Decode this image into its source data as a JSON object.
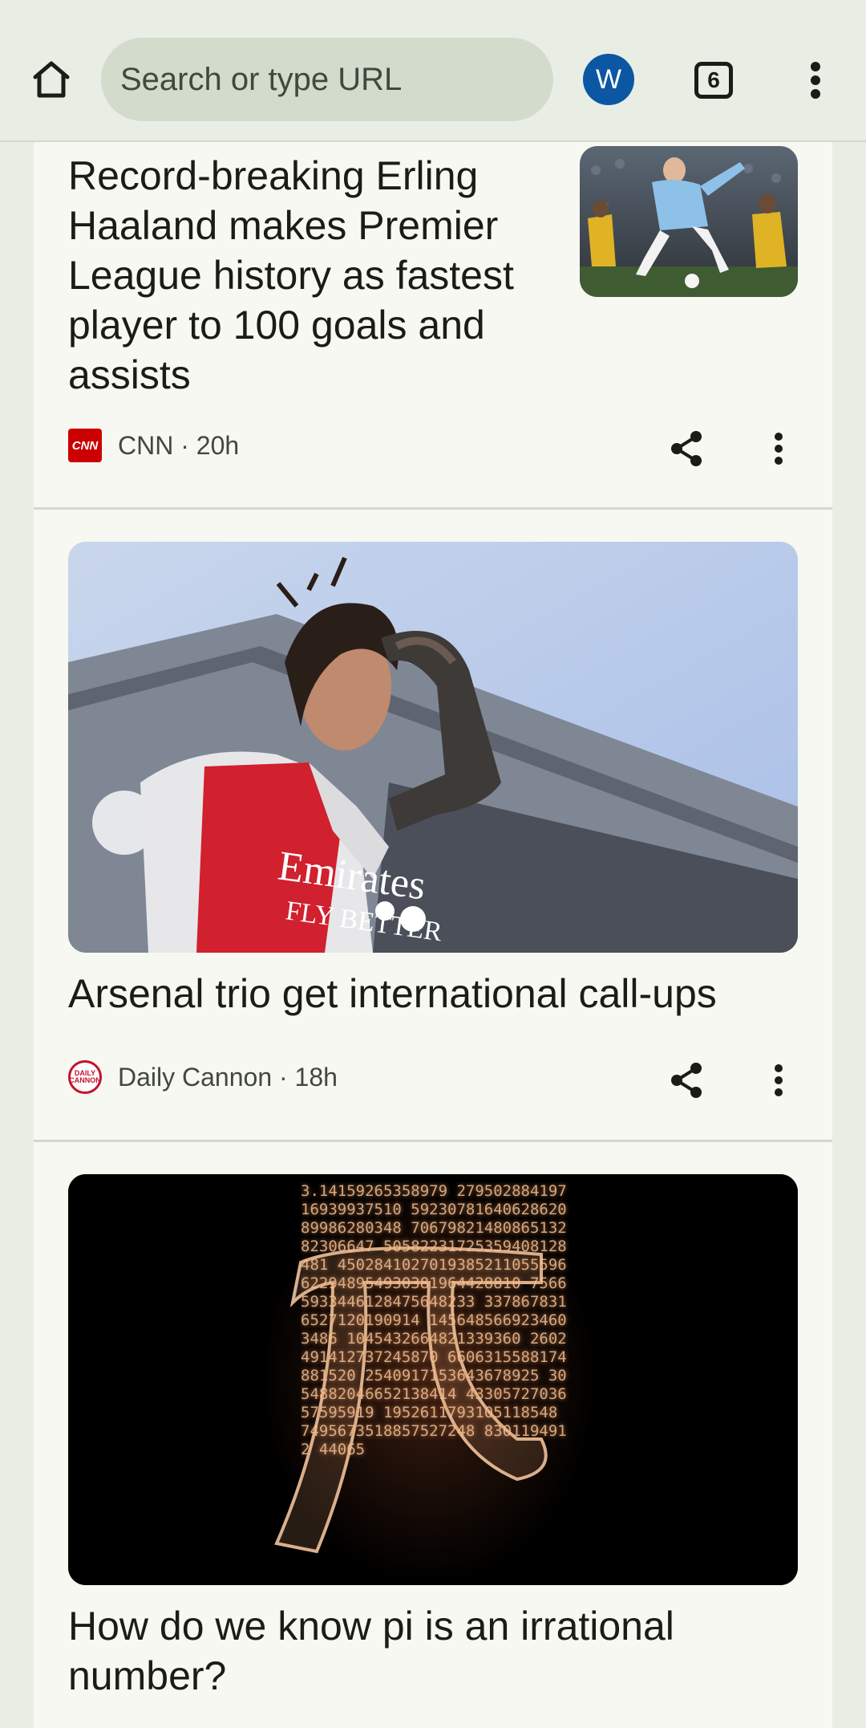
{
  "toolbar": {
    "search_placeholder": "Search or type URL",
    "account_initial": "W",
    "tab_count": "6"
  },
  "articles": [
    {
      "headline": "Record-breaking Erling Haaland makes Premier League history as fastest player to 100 goals and assists",
      "source": "CNN",
      "age": "20h",
      "source_icon_text": "CNN"
    },
    {
      "headline": "Arsenal trio get international call-ups",
      "source": "Daily Cannon",
      "age": "18h",
      "source_icon_text": "DAILY CANNON"
    },
    {
      "headline": "How do we know pi is an irrational number?"
    }
  ],
  "pi_image_digits": "3.14159265358979 27950288419716939937510 5923078164062862089986280348 7067982148086513282306647 50582231725359408128481 4502841027019385211055596 622948954930381964428810 75665933446128475648233 3378678316527120190914 1456485669234603486 1045432664821339360 2602491412737245870 6606315588174881520 2540917153643678925 3054882046652138414 4330572703657595919 1952611793105118548 7495673518857527248 8301194912 44065"
}
